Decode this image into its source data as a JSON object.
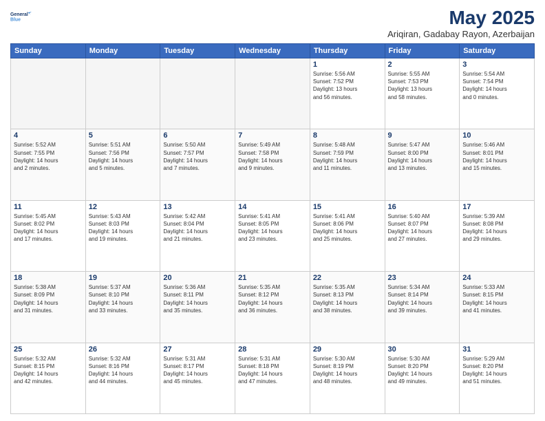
{
  "header": {
    "logo_line1": "General",
    "logo_line2": "Blue",
    "title": "May 2025",
    "subtitle": "Ariqiran, Gadabay Rayon, Azerbaijan"
  },
  "weekdays": [
    "Sunday",
    "Monday",
    "Tuesday",
    "Wednesday",
    "Thursday",
    "Friday",
    "Saturday"
  ],
  "weeks": [
    [
      {
        "day": "",
        "info": ""
      },
      {
        "day": "",
        "info": ""
      },
      {
        "day": "",
        "info": ""
      },
      {
        "day": "",
        "info": ""
      },
      {
        "day": "1",
        "info": "Sunrise: 5:56 AM\nSunset: 7:52 PM\nDaylight: 13 hours\nand 56 minutes."
      },
      {
        "day": "2",
        "info": "Sunrise: 5:55 AM\nSunset: 7:53 PM\nDaylight: 13 hours\nand 58 minutes."
      },
      {
        "day": "3",
        "info": "Sunrise: 5:54 AM\nSunset: 7:54 PM\nDaylight: 14 hours\nand 0 minutes."
      }
    ],
    [
      {
        "day": "4",
        "info": "Sunrise: 5:52 AM\nSunset: 7:55 PM\nDaylight: 14 hours\nand 2 minutes."
      },
      {
        "day": "5",
        "info": "Sunrise: 5:51 AM\nSunset: 7:56 PM\nDaylight: 14 hours\nand 5 minutes."
      },
      {
        "day": "6",
        "info": "Sunrise: 5:50 AM\nSunset: 7:57 PM\nDaylight: 14 hours\nand 7 minutes."
      },
      {
        "day": "7",
        "info": "Sunrise: 5:49 AM\nSunset: 7:58 PM\nDaylight: 14 hours\nand 9 minutes."
      },
      {
        "day": "8",
        "info": "Sunrise: 5:48 AM\nSunset: 7:59 PM\nDaylight: 14 hours\nand 11 minutes."
      },
      {
        "day": "9",
        "info": "Sunrise: 5:47 AM\nSunset: 8:00 PM\nDaylight: 14 hours\nand 13 minutes."
      },
      {
        "day": "10",
        "info": "Sunrise: 5:46 AM\nSunset: 8:01 PM\nDaylight: 14 hours\nand 15 minutes."
      }
    ],
    [
      {
        "day": "11",
        "info": "Sunrise: 5:45 AM\nSunset: 8:02 PM\nDaylight: 14 hours\nand 17 minutes."
      },
      {
        "day": "12",
        "info": "Sunrise: 5:43 AM\nSunset: 8:03 PM\nDaylight: 14 hours\nand 19 minutes."
      },
      {
        "day": "13",
        "info": "Sunrise: 5:42 AM\nSunset: 8:04 PM\nDaylight: 14 hours\nand 21 minutes."
      },
      {
        "day": "14",
        "info": "Sunrise: 5:41 AM\nSunset: 8:05 PM\nDaylight: 14 hours\nand 23 minutes."
      },
      {
        "day": "15",
        "info": "Sunrise: 5:41 AM\nSunset: 8:06 PM\nDaylight: 14 hours\nand 25 minutes."
      },
      {
        "day": "16",
        "info": "Sunrise: 5:40 AM\nSunset: 8:07 PM\nDaylight: 14 hours\nand 27 minutes."
      },
      {
        "day": "17",
        "info": "Sunrise: 5:39 AM\nSunset: 8:08 PM\nDaylight: 14 hours\nand 29 minutes."
      }
    ],
    [
      {
        "day": "18",
        "info": "Sunrise: 5:38 AM\nSunset: 8:09 PM\nDaylight: 14 hours\nand 31 minutes."
      },
      {
        "day": "19",
        "info": "Sunrise: 5:37 AM\nSunset: 8:10 PM\nDaylight: 14 hours\nand 33 minutes."
      },
      {
        "day": "20",
        "info": "Sunrise: 5:36 AM\nSunset: 8:11 PM\nDaylight: 14 hours\nand 35 minutes."
      },
      {
        "day": "21",
        "info": "Sunrise: 5:35 AM\nSunset: 8:12 PM\nDaylight: 14 hours\nand 36 minutes."
      },
      {
        "day": "22",
        "info": "Sunrise: 5:35 AM\nSunset: 8:13 PM\nDaylight: 14 hours\nand 38 minutes."
      },
      {
        "day": "23",
        "info": "Sunrise: 5:34 AM\nSunset: 8:14 PM\nDaylight: 14 hours\nand 39 minutes."
      },
      {
        "day": "24",
        "info": "Sunrise: 5:33 AM\nSunset: 8:15 PM\nDaylight: 14 hours\nand 41 minutes."
      }
    ],
    [
      {
        "day": "25",
        "info": "Sunrise: 5:32 AM\nSunset: 8:15 PM\nDaylight: 14 hours\nand 42 minutes."
      },
      {
        "day": "26",
        "info": "Sunrise: 5:32 AM\nSunset: 8:16 PM\nDaylight: 14 hours\nand 44 minutes."
      },
      {
        "day": "27",
        "info": "Sunrise: 5:31 AM\nSunset: 8:17 PM\nDaylight: 14 hours\nand 45 minutes."
      },
      {
        "day": "28",
        "info": "Sunrise: 5:31 AM\nSunset: 8:18 PM\nDaylight: 14 hours\nand 47 minutes."
      },
      {
        "day": "29",
        "info": "Sunrise: 5:30 AM\nSunset: 8:19 PM\nDaylight: 14 hours\nand 48 minutes."
      },
      {
        "day": "30",
        "info": "Sunrise: 5:30 AM\nSunset: 8:20 PM\nDaylight: 14 hours\nand 49 minutes."
      },
      {
        "day": "31",
        "info": "Sunrise: 5:29 AM\nSunset: 8:20 PM\nDaylight: 14 hours\nand 51 minutes."
      }
    ]
  ]
}
